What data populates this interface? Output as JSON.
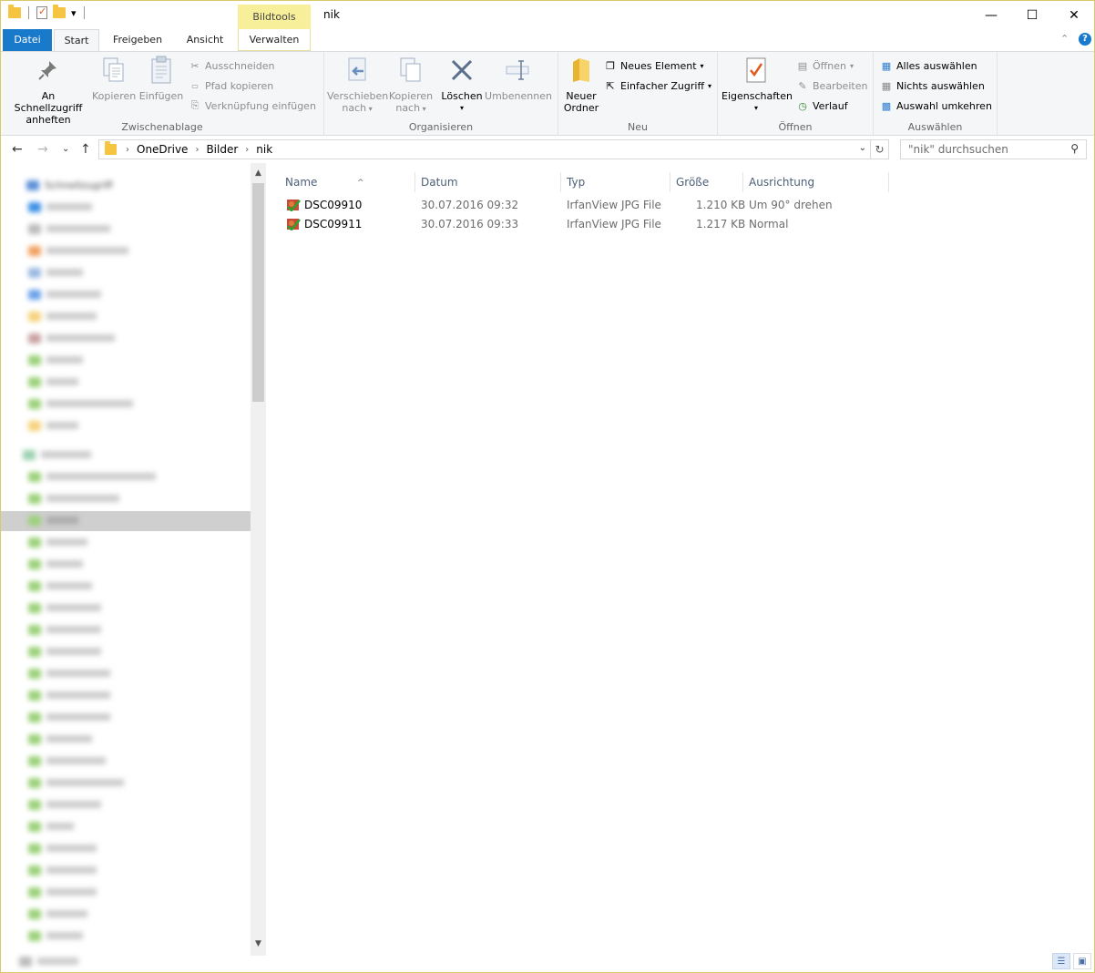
{
  "titlebar": {
    "window_title": "nik",
    "context_tab": "Bildtools",
    "minimize": "—",
    "maximize": "☐",
    "close": "✕",
    "qat_dropdown": "▾"
  },
  "ribbon_tabs": [
    "Datei",
    "Start",
    "Freigeben",
    "Ansicht",
    "Verwalten"
  ],
  "ribbon_controls": {
    "collapse": "⌃",
    "help": "?"
  },
  "ribbon": {
    "clipboard": {
      "label": "Zwischenablage",
      "pin": "An Schnellzugriff anheften",
      "copy": "Kopieren",
      "paste": "Einfügen",
      "cut": "Ausschneiden",
      "copy_path": "Pfad kopieren",
      "paste_shortcut": "Verknüpfung einfügen"
    },
    "organize": {
      "label": "Organisieren",
      "move_to": "Verschieben nach",
      "copy_to": "Kopieren nach",
      "delete": "Löschen",
      "rename": "Umbenennen"
    },
    "new": {
      "label": "Neu",
      "new_folder": "Neuer Ordner",
      "new_item": "Neues Element",
      "easy_access": "Einfacher Zugriff"
    },
    "open": {
      "label": "Öffnen",
      "properties": "Eigenschaften",
      "open": "Öffnen",
      "edit": "Bearbeiten",
      "history": "Verlauf"
    },
    "select": {
      "label": "Auswählen",
      "select_all": "Alles auswählen",
      "select_none": "Nichts auswählen",
      "invert": "Auswahl umkehren"
    }
  },
  "navigation": {
    "back": "←",
    "forward": "→",
    "recent": "⌄",
    "up": "↑",
    "breadcrumb": [
      "OneDrive",
      "Bilder",
      "nik"
    ],
    "crumb_sep": "›",
    "dropdown": "⌄",
    "refresh": "↻",
    "search_placeholder": "\"nik\" durchsuchen"
  },
  "nav_pane": {
    "first_item": "Schnellzugriff",
    "scroll_up": "▲",
    "scroll_down": "▼"
  },
  "file_list": {
    "columns": [
      "Name",
      "Datum",
      "Typ",
      "Größe",
      "Ausrichtung"
    ],
    "sort_indicator": "^",
    "rows": [
      {
        "name": "DSC09910",
        "date": "30.07.2016 09:32",
        "type": "IrfanView JPG File",
        "size": "1.210 KB",
        "orientation": "Um 90° drehen"
      },
      {
        "name": "DSC09911",
        "date": "30.07.2016 09:33",
        "type": "IrfanView JPG File",
        "size": "1.217 KB",
        "orientation": "Normal"
      }
    ]
  },
  "colors": {
    "file_tab": "#1979ca",
    "context_tab": "#f7ef9a",
    "ribbon_bg": "#f5f6f7",
    "header_text": "#4c607a"
  }
}
